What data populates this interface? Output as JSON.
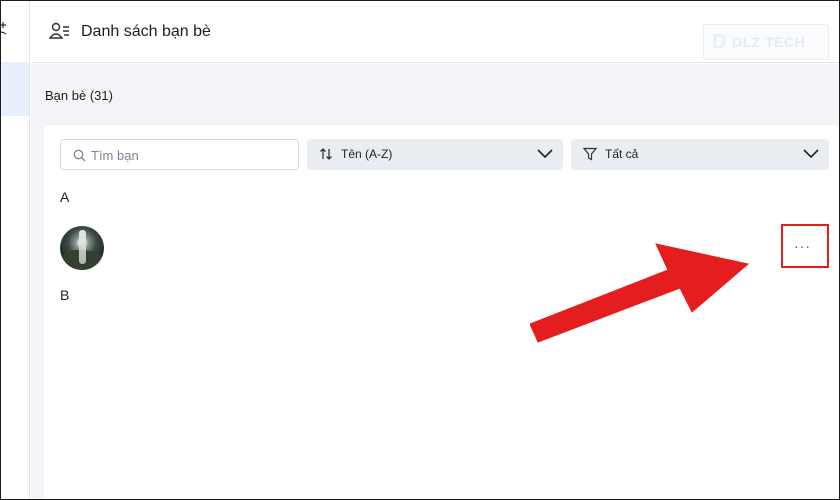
{
  "header": {
    "title": "Danh sách bạn bè"
  },
  "watermark": {
    "text": "DLZ TECH"
  },
  "main": {
    "count_label": "Bạn bè (31)",
    "search": {
      "placeholder": "Tìm bạn",
      "value": ""
    },
    "sort": {
      "label": "Tên (A-Z)"
    },
    "filter": {
      "label": "Tất cả"
    },
    "sections": [
      {
        "letter": "A"
      },
      {
        "letter": "B"
      }
    ],
    "more_button": {
      "label": "···"
    }
  },
  "colors": {
    "accent_red": "#e41e1e",
    "sidebar_active": "#e8f0fd",
    "background": "#f3f4f7"
  },
  "icons": [
    "person-list-icon",
    "search-icon",
    "sort-icon",
    "filter-icon",
    "chevron-down-icon",
    "more-options-icon",
    "red-arrow"
  ]
}
